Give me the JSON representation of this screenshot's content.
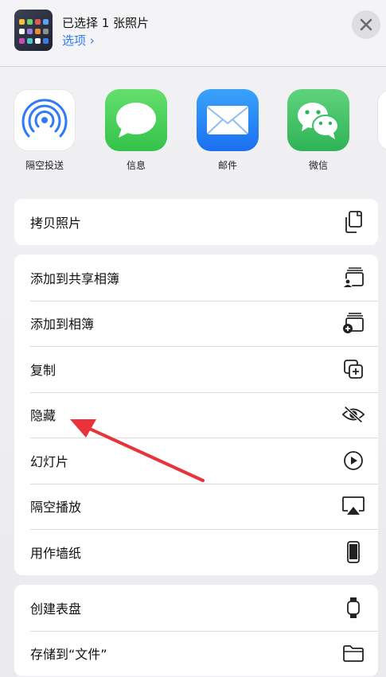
{
  "header": {
    "title": "已选择 1 张照片",
    "options_label": "选项 ›"
  },
  "apps": [
    {
      "label": "隔空投送",
      "icon": "airdrop-icon",
      "color": "#2f7bf5"
    },
    {
      "label": "信息",
      "icon": "messages-icon",
      "color": "#4cd964"
    },
    {
      "label": "邮件",
      "icon": "mail-icon",
      "color": "#2a8cf7"
    },
    {
      "label": "微信",
      "icon": "wechat-icon",
      "color": "#3ec16a"
    }
  ],
  "groups": [
    {
      "items": [
        {
          "label": "拷贝照片",
          "icon": "copy-photo-icon"
        }
      ]
    },
    {
      "items": [
        {
          "label": "添加到共享相簿",
          "icon": "shared-album-icon"
        },
        {
          "label": "添加到相簿",
          "icon": "add-album-icon"
        },
        {
          "label": "复制",
          "icon": "duplicate-icon"
        },
        {
          "label": "隐藏",
          "icon": "eye-slash-icon"
        },
        {
          "label": "幻灯片",
          "icon": "play-circle-icon"
        },
        {
          "label": "隔空播放",
          "icon": "airplay-icon"
        },
        {
          "label": "用作墙纸",
          "icon": "phone-icon"
        }
      ]
    },
    {
      "items": [
        {
          "label": "创建表盘",
          "icon": "watch-icon"
        },
        {
          "label": "存储到“文件”",
          "icon": "folder-icon"
        }
      ]
    }
  ],
  "colors": {
    "accent": "#2f7bf5",
    "annotation_arrow": "#e8333a"
  }
}
